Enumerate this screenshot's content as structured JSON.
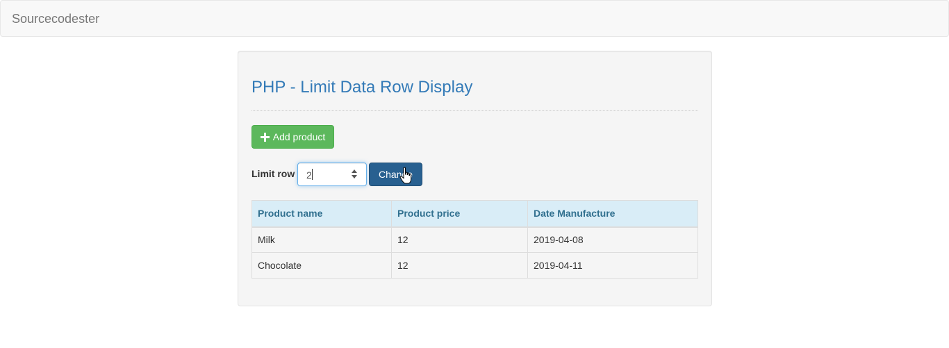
{
  "navbar": {
    "brand": "Sourcecodester"
  },
  "panel": {
    "title": "PHP - Limit Data Row Display",
    "add_button_label": "Add product",
    "limit_label": "Limit row",
    "limit_value": "2",
    "change_button_label": "Change"
  },
  "table": {
    "headers": [
      "Product name",
      "Product price",
      "Date Manufacture"
    ],
    "rows": [
      [
        "Milk",
        "12",
        "2019-04-08"
      ],
      [
        "Chocolate",
        "12",
        "2019-04-11"
      ]
    ]
  },
  "icons": {
    "add": "plus-icon",
    "spinner": "number-spinner-icon",
    "cursor": "hand-pointer-cursor-icon"
  },
  "colors": {
    "title": "#337ab7",
    "add_button": "#5cb85c",
    "change_button": "#286090",
    "table_header_bg": "#d9edf7",
    "table_header_text": "#31708f"
  }
}
